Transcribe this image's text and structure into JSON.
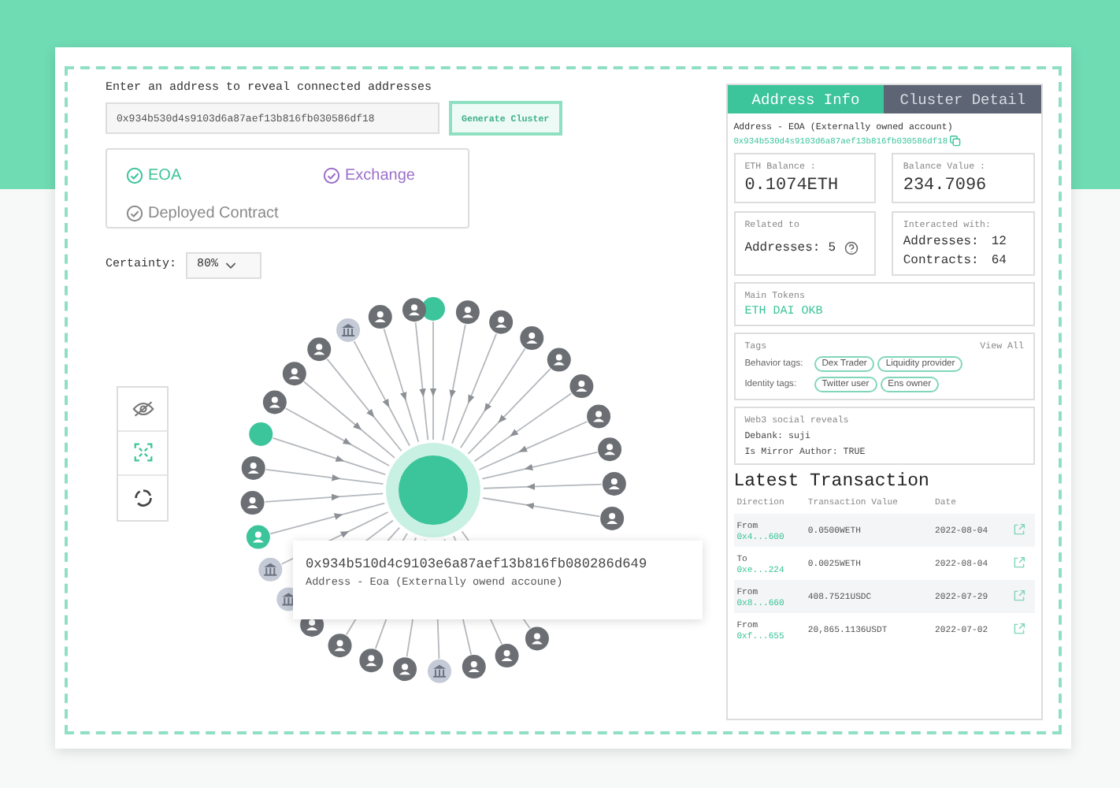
{
  "search": {
    "label": "Enter an address to reveal connected addresses",
    "value": "0x934b530d4s9103d6a87aef13b816fb030586df18",
    "button": "Generate Cluster"
  },
  "filters": [
    {
      "label": "EOA",
      "color": "#3cc49a"
    },
    {
      "label": "Exchange",
      "color": "#9b6fc9"
    },
    {
      "label": "Deployed Contract",
      "color": "#8a8a8a"
    }
  ],
  "certainty": {
    "label": "Certainty:",
    "value": "80%"
  },
  "graph": {
    "nodes": [
      {
        "kind": "highlight"
      },
      {
        "kind": "user"
      },
      {
        "kind": "user"
      },
      {
        "kind": "user"
      },
      {
        "kind": "user"
      },
      {
        "kind": "user"
      },
      {
        "kind": "user"
      },
      {
        "kind": "user"
      },
      {
        "kind": "user"
      },
      {
        "kind": "user"
      },
      {
        "kind": "user"
      },
      {
        "kind": "user"
      },
      {
        "kind": "user"
      },
      {
        "kind": "bank"
      },
      {
        "kind": "user"
      },
      {
        "kind": "user"
      },
      {
        "kind": "user"
      },
      {
        "kind": "user"
      },
      {
        "kind": "bank"
      },
      {
        "kind": "bank"
      },
      {
        "kind": "highlight-user"
      },
      {
        "kind": "user"
      },
      {
        "kind": "user"
      },
      {
        "kind": "highlight"
      },
      {
        "kind": "user"
      },
      {
        "kind": "user"
      },
      {
        "kind": "user"
      },
      {
        "kind": "bank"
      },
      {
        "kind": "user"
      },
      {
        "kind": "user"
      }
    ],
    "tooltip": {
      "address": "0x934b510d4c9103e6a87aef13b816fb080286d649",
      "type": "Address - Eoa (Externally owend accoune)"
    }
  },
  "tabs": [
    {
      "label": "Address Info",
      "selected": true
    },
    {
      "label": "Cluster Detail",
      "selected": false
    }
  ],
  "address_info": {
    "type": "Address - EOA (Externally owned account)",
    "address": "0x934b530d4s9103d6a87aef13b816fb030586df18",
    "stats": [
      {
        "label": "ETH Balance :",
        "value": "0.1074ETH"
      },
      {
        "label": "Balance Value :",
        "value": "234.7096"
      }
    ],
    "related": {
      "label": "Related to",
      "key": "Addresses:",
      "value": "5"
    },
    "interacted": {
      "label": "Interacted with:",
      "rows": [
        {
          "key": "Addresses:",
          "value": "12"
        },
        {
          "key": "Contracts:",
          "value": "64"
        }
      ]
    },
    "tokens": {
      "label": "Main Tokens",
      "value": "ETH DAI OKB"
    },
    "tags": {
      "label": "Tags",
      "link": "View All",
      "groups": [
        {
          "label": "Behavior tags:",
          "tags": [
            "Dex Trader",
            "Liquidity provider"
          ]
        },
        {
          "label": "Identity tags:",
          "tags": [
            "Twitter user",
            "Ens owner"
          ]
        }
      ]
    },
    "social": {
      "label": "Web3 social reveals",
      "lines": [
        "Debank: suji",
        "Is Mirror Author: TRUE"
      ]
    }
  },
  "transactions": {
    "title": "Latest Transaction",
    "columns": [
      "Direction",
      "Transaction Value",
      "Date"
    ],
    "rows": [
      {
        "direction": "From",
        "address": "0x4...600",
        "value": "0.0500WETH",
        "date": "2022-08-04"
      },
      {
        "direction": "To",
        "address": "0xe...224",
        "value": "0.0025WETH",
        "date": "2022-08-04"
      },
      {
        "direction": "From",
        "address": "0x8...660",
        "value": "408.7521USDC",
        "date": "2022-07-29"
      },
      {
        "direction": "From",
        "address": "0xf...655",
        "value": "20,865.1136USDT",
        "date": "2022-07-02"
      }
    ]
  }
}
